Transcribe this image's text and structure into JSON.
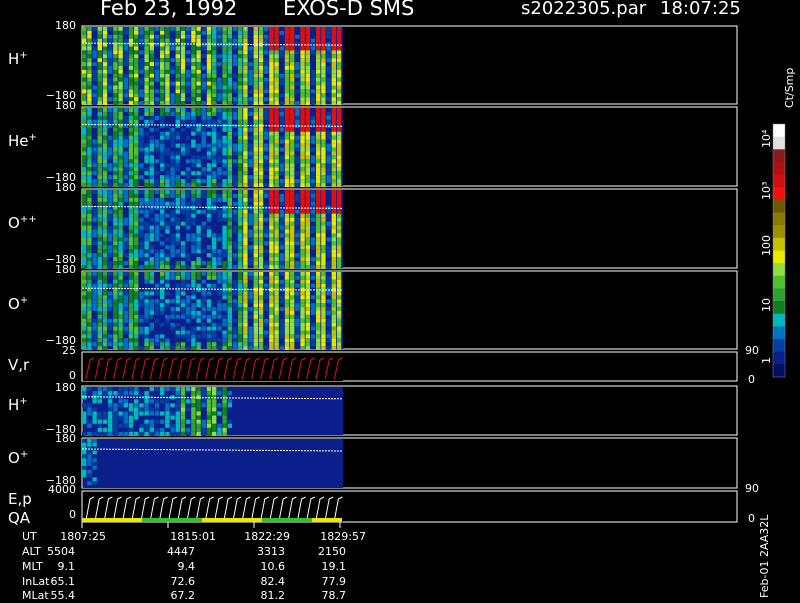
{
  "header": {
    "date": "Feb 23, 1992",
    "instrument": "EXOS-D SMS",
    "file": "s2022305.par",
    "time": "18:07:25"
  },
  "colors": {
    "background": "#000000",
    "frame": "#ffffff",
    "low": "#0a1f8a",
    "mid": "#2dbd2d",
    "high": "#e01010"
  },
  "colorbar": {
    "unit": "Ct/Smp",
    "labels": [
      "10⁴",
      "10³",
      "100",
      "10",
      "1"
    ],
    "colors": [
      "#ffffff",
      "#e0e0e0",
      "#8a1c1c",
      "#b01010",
      "#d01010",
      "#f01010",
      "#6a5a00",
      "#8a7a00",
      "#a09000",
      "#c8c000",
      "#e8e800",
      "#90e040",
      "#50c030",
      "#30a030",
      "#108020",
      "#00b8b8",
      "#0070c0",
      "#0040a0",
      "#0a1f8a",
      "#001060"
    ]
  },
  "panels": [
    {
      "label_main": "H",
      "label_sup": "+",
      "ytop": "180",
      "ybot": "−180"
    },
    {
      "label_main": "He",
      "label_sup": "+",
      "ytop": "180",
      "ybot": "−180"
    },
    {
      "label_main": "O",
      "label_sup": "++",
      "ytop": "180",
      "ybot": "−180"
    },
    {
      "label_main": "O",
      "label_sup": "+",
      "ytop": "180",
      "ybot": "−180"
    },
    {
      "label_main": "V,r",
      "label_sup": "",
      "ytop": "25",
      "ybot": "0",
      "rtop": "90",
      "rbot": "0"
    },
    {
      "label_main": "H",
      "label_sup": "+",
      "ytop": "180",
      "ybot": "−180"
    },
    {
      "label_main": "O",
      "label_sup": "+",
      "ytop": "180",
      "ybot": "−180"
    },
    {
      "label_main": "E,p",
      "label_sup": "",
      "label2": "QA",
      "ytop": "4000",
      "ybot": "0",
      "rtop": "90",
      "rbot": "0"
    }
  ],
  "side_label": "Feb-01 2AA32L",
  "table": {
    "columns": [
      "1807:25",
      "1815:01",
      "1822:29",
      "1829:57"
    ],
    "rows": [
      {
        "name": "UT",
        "values": [
          "1807:25",
          "1815:01",
          "1822:29",
          "1829:57"
        ]
      },
      {
        "name": "ALT",
        "values": [
          "5504",
          "4447",
          "3313",
          "2150"
        ]
      },
      {
        "name": "MLT",
        "values": [
          "9.1",
          "9.4",
          "10.6",
          "19.1"
        ]
      },
      {
        "name": "InLat",
        "values": [
          "65.1",
          "72.6",
          "82.4",
          "77.9"
        ]
      },
      {
        "name": "MLat",
        "values": [
          "55.4",
          "67.2",
          "81.2",
          "78.7"
        ]
      }
    ]
  },
  "chart_data": {
    "type": "heatmap",
    "title": "Feb 23, 1992   EXOS-D SMS",
    "x_ticks": [
      "1807:25",
      "1815:01",
      "1822:29",
      "1829:57"
    ],
    "series": [
      {
        "name": "H+",
        "ylim": [
          -180,
          180
        ]
      },
      {
        "name": "He+",
        "ylim": [
          -180,
          180
        ]
      },
      {
        "name": "O++",
        "ylim": [
          -180,
          180
        ]
      },
      {
        "name": "O+",
        "ylim": [
          -180,
          180
        ]
      },
      {
        "name": "V,r",
        "ylim": [
          0,
          25
        ]
      },
      {
        "name": "H+",
        "ylim": [
          -180,
          180
        ]
      },
      {
        "name": "O+",
        "ylim": [
          -180,
          180
        ]
      },
      {
        "name": "E,p",
        "ylim": [
          0,
          4000
        ]
      }
    ],
    "colorbar_unit": "Ct/Smp",
    "colorbar_ticks": [
      "1",
      "10",
      "100",
      "10³",
      "10⁴"
    ]
  }
}
